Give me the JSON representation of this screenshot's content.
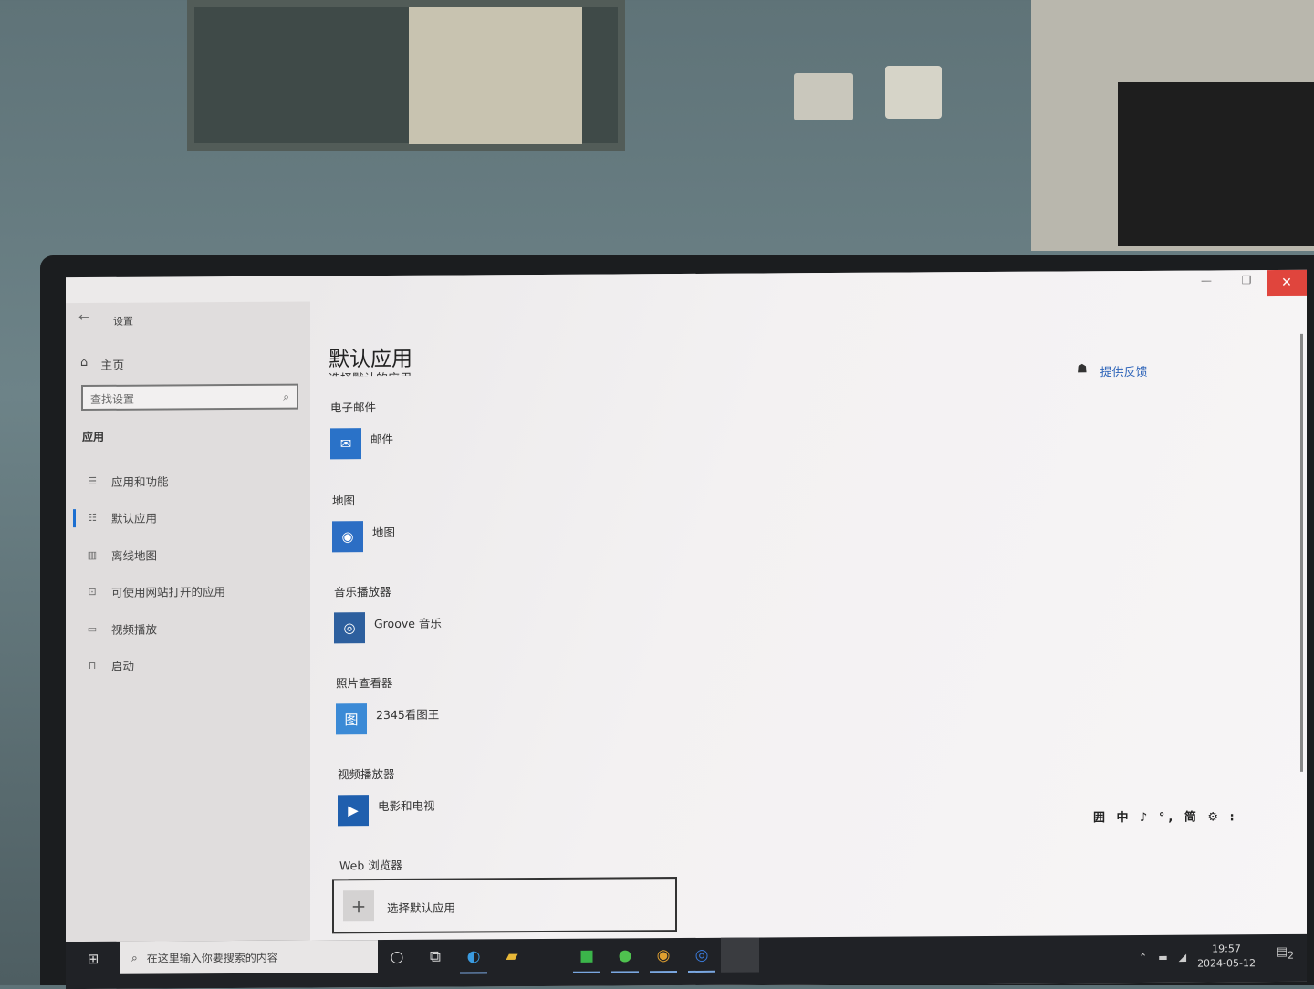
{
  "window": {
    "title": "设置",
    "back_icon": "arrow-left-icon",
    "minimize": "—",
    "restore": "❐",
    "close": "✕"
  },
  "sidebar": {
    "home": "主页",
    "search_placeholder": "查找设置",
    "section": "应用",
    "items": [
      {
        "label": "应用和功能",
        "icon": "list-icon"
      },
      {
        "label": "默认应用",
        "icon": "default-apps-icon",
        "active": true
      },
      {
        "label": "离线地图",
        "icon": "map-icon"
      },
      {
        "label": "可使用网站打开的应用",
        "icon": "website-icon"
      },
      {
        "label": "视频播放",
        "icon": "video-icon"
      },
      {
        "label": "启动",
        "icon": "startup-icon"
      }
    ]
  },
  "main": {
    "title": "默认应用",
    "subtitle": "选择默认的应用",
    "feedback": "提供反馈",
    "groups": [
      {
        "label": "电子邮件",
        "app": "邮件",
        "color": "#2a72c8",
        "glyph": "✉"
      },
      {
        "label": "地图",
        "app": "地图",
        "color": "#2c6ec4",
        "glyph": "◉"
      },
      {
        "label": "音乐播放器",
        "app": "Groove 音乐",
        "color": "#2d5f9e",
        "glyph": "◎"
      },
      {
        "label": "照片查看器",
        "app": "2345看图王",
        "color": "#3b8ad6",
        "glyph": "图"
      },
      {
        "label": "视频播放器",
        "app": "电影和电视",
        "color": "#1f5fae",
        "glyph": "▶"
      }
    ],
    "web_browser": {
      "label": "Web 浏览器",
      "button": "选择默认应用"
    }
  },
  "ime": "囲 中 ♪ °, 简 ⚙ :",
  "taskbar": {
    "search_placeholder": "在这里输入你要搜索的内容",
    "apps": [
      "cortana",
      "task-view",
      "edge",
      "file-explorer",
      "green-app",
      "wechat",
      "chrome",
      "qq-browser"
    ],
    "time": "19:57",
    "date": "2024-05-12",
    "notifications": "2"
  },
  "colors": {
    "accent": "#1c6fd1",
    "close": "#e0453d",
    "link": "#2b62b8"
  }
}
